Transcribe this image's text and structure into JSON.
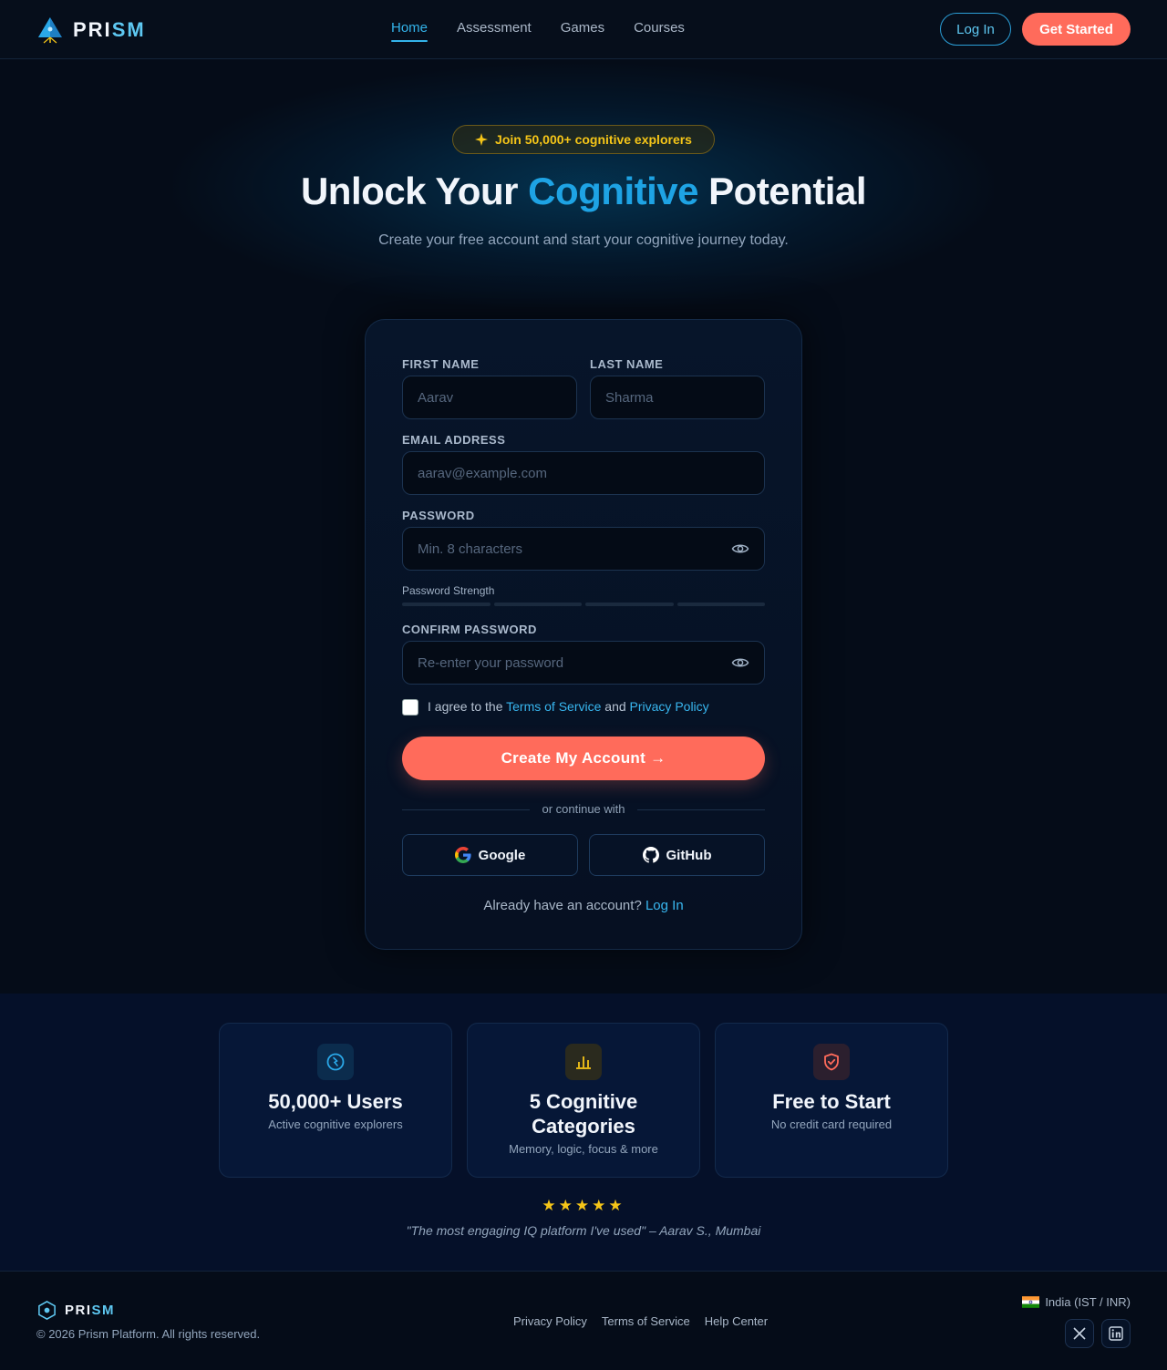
{
  "nav": {
    "brand_a": "PRI",
    "brand_b": "SM",
    "links": [
      "Home",
      "Assessment",
      "Games",
      "Courses"
    ],
    "active_link": "Home",
    "login_label": "Log In",
    "get_started_label": "Get Started"
  },
  "hero": {
    "badge": "Join 50,000+ cognitive explorers",
    "title_a": "Unlock Your ",
    "title_hl": "Cognitive",
    "title_b": " Potential",
    "subtitle": "Create your free account and start your cognitive journey today."
  },
  "form": {
    "first_name_label": "FIRST NAME",
    "first_name_placeholder": "Aarav",
    "last_name_label": "LAST NAME",
    "last_name_placeholder": "Sharma",
    "email_label": "EMAIL ADDRESS",
    "email_placeholder": "aarav@example.com",
    "password_label": "PASSWORD",
    "password_placeholder": "Min. 8 characters",
    "strength_label": "Password Strength",
    "confirm_label": "CONFIRM PASSWORD",
    "confirm_placeholder": "Re-enter your password",
    "agree_prefix": "I agree to the ",
    "terms_link": "Terms of Service",
    "agree_and": " and ",
    "privacy_link": "Privacy Policy",
    "submit_label": "Create My Account  →",
    "divider_text": "or continue with",
    "google_label": "Google",
    "github_label": "GitHub",
    "already_text": "Already have an account? ",
    "login_link": "Log In"
  },
  "stats": [
    {
      "title": "50,000+ Users",
      "subtitle": "Active cognitive explorers",
      "icon": "brain-icon",
      "color": "#2aa8e8"
    },
    {
      "title": "5 Cognitive Categories",
      "subtitle": "Memory, logic, focus & more",
      "icon": "bar-chart-icon",
      "color": "#f5c518"
    },
    {
      "title": "Free to Start",
      "subtitle": "No credit card required",
      "icon": "shield-check-icon",
      "color": "#ff6b5b"
    }
  ],
  "testimonial": {
    "stars": "★★★★★",
    "quote": "\"The most engaging IQ platform I've used\" – Aarav S., Mumbai"
  },
  "footer": {
    "brand_a": "PRI",
    "brand_b": "SM",
    "copyright": "© 2026 Prism Platform. All rights reserved.",
    "links": [
      "Privacy Policy",
      "Terms of Service",
      "Help Center"
    ],
    "region": "India (IST / INR)"
  },
  "colors": {
    "accent": "#1ea3e4",
    "cta": "#ff6b5b",
    "gold": "#f5c518",
    "background": "#050c18"
  }
}
